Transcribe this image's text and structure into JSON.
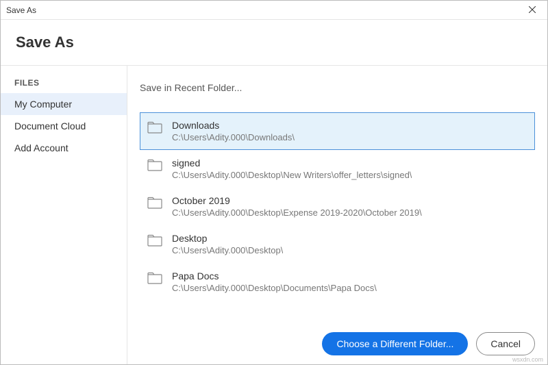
{
  "titlebar": {
    "title": "Save As"
  },
  "header": {
    "title": "Save As"
  },
  "sidebar": {
    "header": "FILES",
    "items": [
      {
        "label": "My Computer",
        "active": true
      },
      {
        "label": "Document Cloud",
        "active": false
      },
      {
        "label": "Add Account",
        "active": false
      }
    ]
  },
  "main": {
    "section_title": "Save in Recent Folder...",
    "folders": [
      {
        "name": "Downloads",
        "path": "C:\\Users\\Adity.000\\Downloads\\",
        "selected": true
      },
      {
        "name": "signed",
        "path": "C:\\Users\\Adity.000\\Desktop\\New Writers\\offer_letters\\signed\\",
        "selected": false
      },
      {
        "name": "October 2019",
        "path": "C:\\Users\\Adity.000\\Desktop\\Expense 2019-2020\\October 2019\\",
        "selected": false
      },
      {
        "name": "Desktop",
        "path": "C:\\Users\\Adity.000\\Desktop\\",
        "selected": false
      },
      {
        "name": "Papa Docs",
        "path": "C:\\Users\\Adity.000\\Desktop\\Documents\\Papa Docs\\",
        "selected": false
      }
    ]
  },
  "footer": {
    "primary": "Choose a Different Folder...",
    "secondary": "Cancel"
  },
  "watermark": "wsxdn.com"
}
